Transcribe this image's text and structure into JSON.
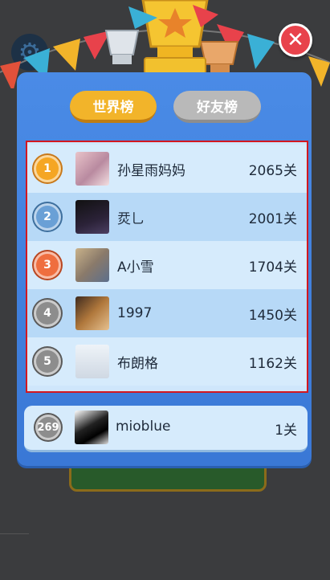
{
  "tabs": {
    "world": "世界榜",
    "friends": "好友榜"
  },
  "close_icon": "close-icon",
  "leaderboard": [
    {
      "rank": "1",
      "name": "孙星雨妈妈",
      "score": "2065关"
    },
    {
      "rank": "2",
      "name": "烎乚",
      "score": "2001关"
    },
    {
      "rank": "3",
      "name": "A小雪",
      "score": "1704关"
    },
    {
      "rank": "4",
      "name": "1997",
      "score": "1450关"
    },
    {
      "rank": "5",
      "name": "布朗格",
      "score": "1162关"
    }
  ],
  "me": {
    "rank": "269",
    "name": "mioblue",
    "score": "1关"
  },
  "colors": {
    "panel": "#3a78d6",
    "active_tab": "#f2b42a",
    "inactive_tab": "#b9b9b9",
    "highlight_border": "#d3171f"
  }
}
